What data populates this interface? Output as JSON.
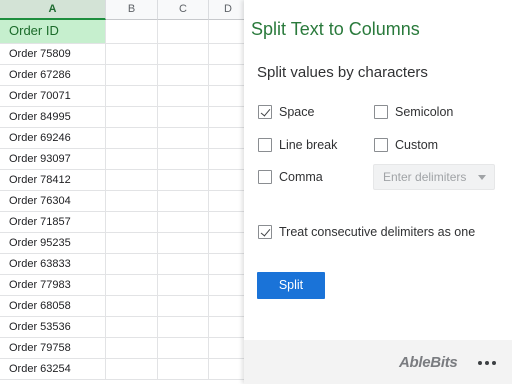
{
  "sheet": {
    "columns": [
      "A",
      "B",
      "C",
      "D"
    ],
    "selected_column": "A",
    "header_cell": "Order ID",
    "rows": [
      "Order 75809",
      "Order 67286",
      "Order 70071",
      "Order 84995",
      "Order 69246",
      "Order 93097",
      "Order 78412",
      "Order 76304",
      "Order 71857",
      "Order 95235",
      "Order 63833",
      "Order 77983",
      "Order 68058",
      "Order 53536",
      "Order 79758",
      "Order 63254"
    ]
  },
  "panel": {
    "title": "Split Text to Columns",
    "section_title": "Split values by characters",
    "options": {
      "space": {
        "label": "Space",
        "checked": true
      },
      "semicolon": {
        "label": "Semicolon",
        "checked": false
      },
      "line_break": {
        "label": "Line break",
        "checked": false
      },
      "custom": {
        "label": "Custom",
        "checked": false
      },
      "comma": {
        "label": "Comma",
        "checked": false
      }
    },
    "delimiters_placeholder": "Enter delimiters",
    "consecutive": {
      "label": "Treat consecutive delimiters as one",
      "checked": true
    },
    "split_button": "Split",
    "brand": "AbleBits"
  },
  "colors": {
    "title_green": "#2a7a3c",
    "header_fill": "#c6efce",
    "button_blue": "#1a73d8"
  }
}
